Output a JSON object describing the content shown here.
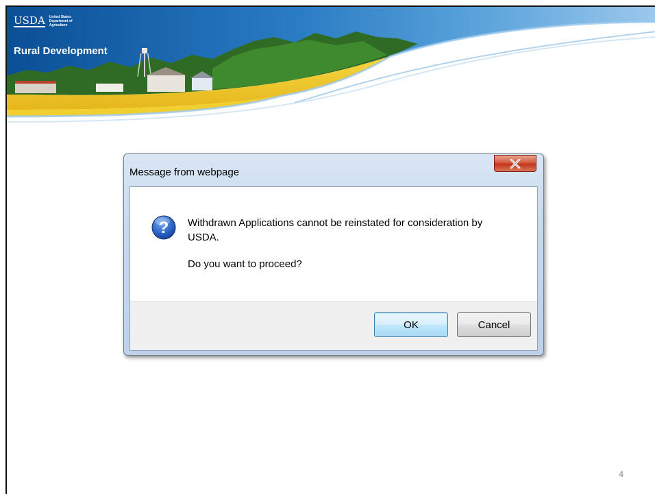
{
  "header": {
    "usda_word": "USDA",
    "usda_lines": [
      "United States",
      "Department of",
      "Agriculture"
    ],
    "agency_name": "Rural Development"
  },
  "dialog": {
    "title": "Message from webpage",
    "close_icon": "close-icon",
    "question_icon": "question-icon",
    "message": "Withdrawn Applications cannot be reinstated for consideration by USDA.",
    "prompt": "Do you want to proceed?",
    "ok_label": "OK",
    "cancel_label": "Cancel"
  },
  "slide_number": "4",
  "colors": {
    "sky_blue": "#0f5ea8",
    "banner_yellow": "#f2c928",
    "dialog_frame": "#c6d8ec",
    "close_red": "#c3371b",
    "ok_border": "#3c7fb1"
  }
}
